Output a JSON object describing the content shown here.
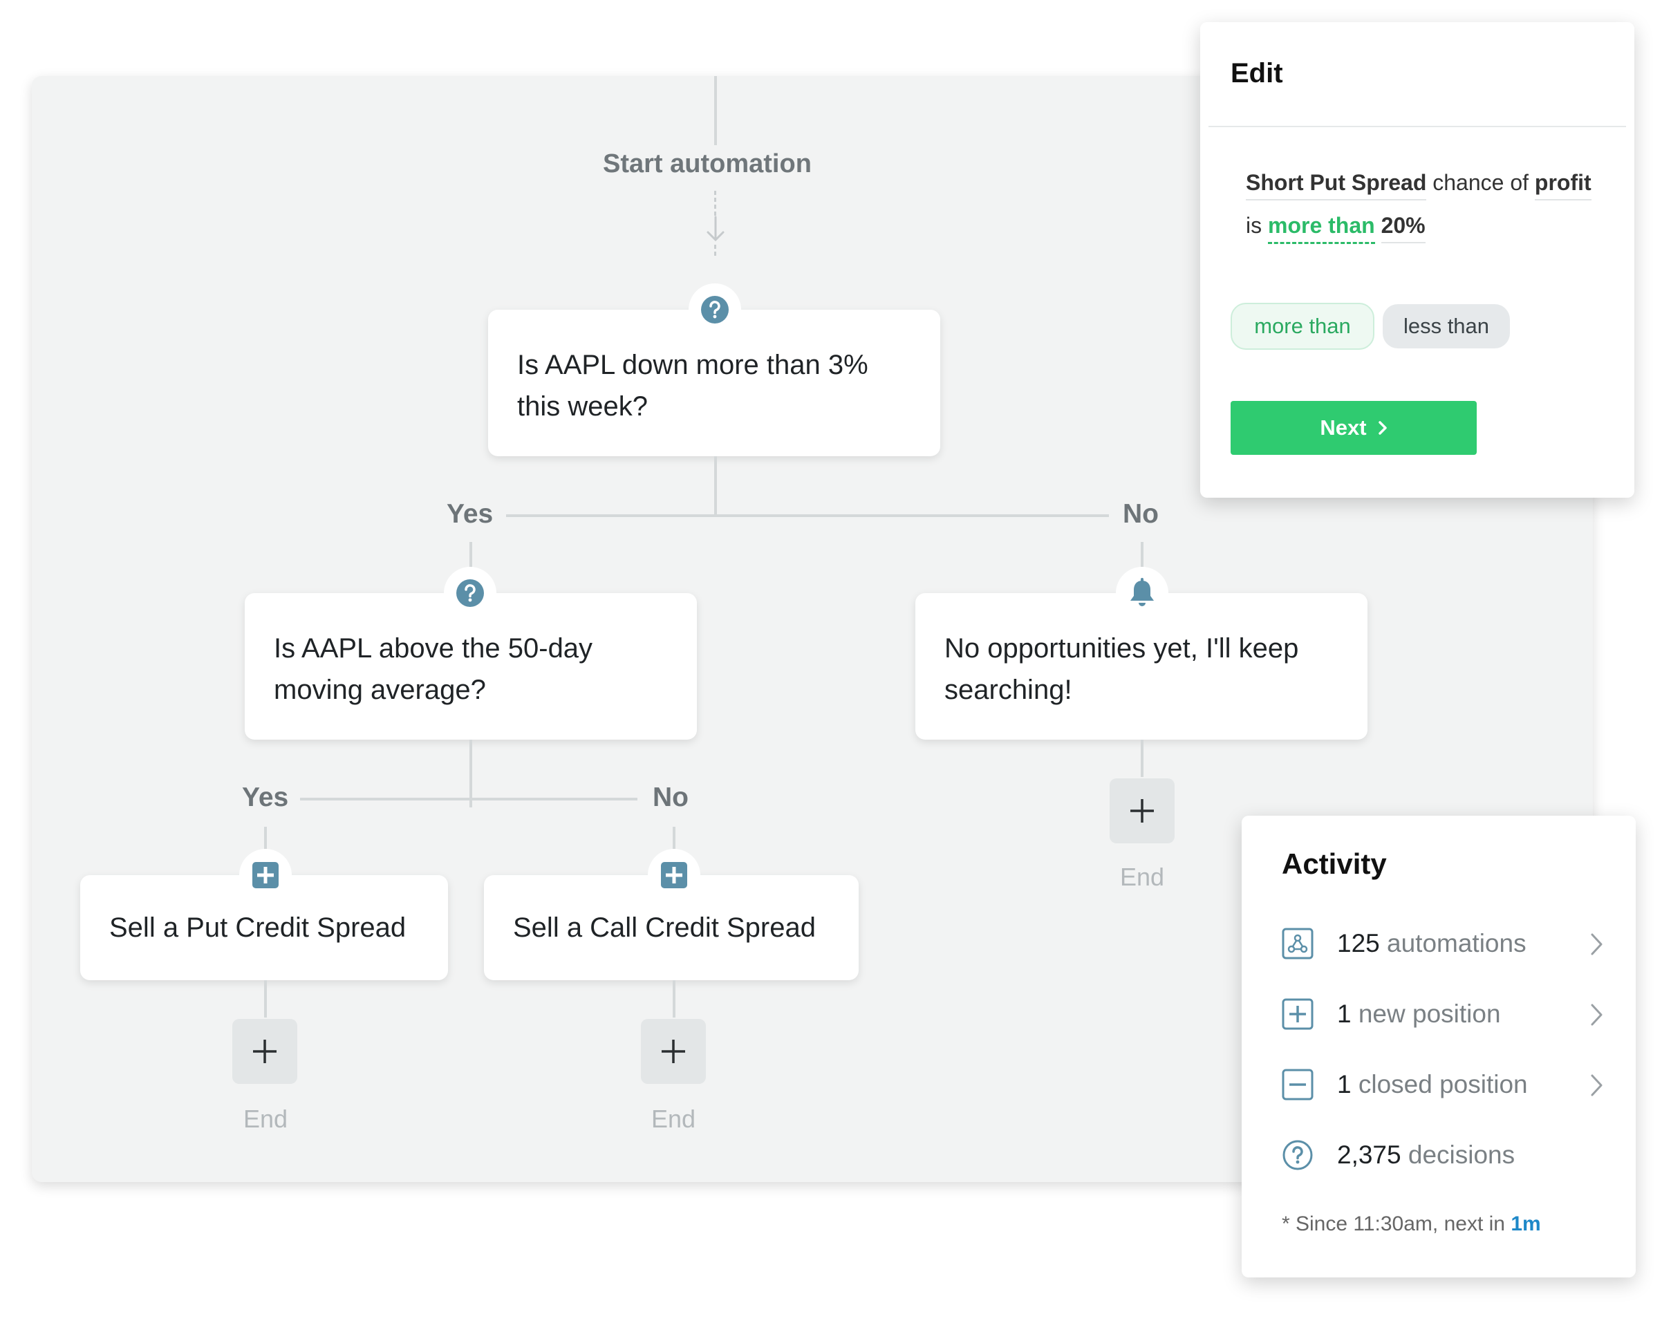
{
  "flow": {
    "start_label": "Start automation",
    "question1": "Is AAPL down more than 3% this week?",
    "yes1": "Yes",
    "no1": "No",
    "question2": "Is AAPL above the 50-day moving average?",
    "notify": "No opportunities yet, I'll keep searching!",
    "yes2": "Yes",
    "no2": "No",
    "action_put": "Sell a Put Credit Spread",
    "action_call": "Sell a Call Credit Spread",
    "end_label": "End"
  },
  "edit": {
    "title": "Edit",
    "condition": {
      "subject": "Short Put Spread",
      "word_chance": "chance",
      "word_of": "of",
      "metric": "profit",
      "word_is": "is",
      "operator": "more than",
      "value": "20%"
    },
    "options": [
      "more than",
      "less than"
    ],
    "next_label": "Next"
  },
  "activity": {
    "title": "Activity",
    "rows": [
      {
        "count": "125",
        "label": "automations",
        "icon": "automation-icon",
        "has_chevron": true
      },
      {
        "count": "1",
        "label": "new position",
        "icon": "plus-square-icon",
        "has_chevron": true
      },
      {
        "count": "1",
        "label": "closed position",
        "icon": "minus-square-icon",
        "has_chevron": true
      },
      {
        "count": "2,375",
        "label": "decisions",
        "icon": "question-circle-icon",
        "has_chevron": false
      }
    ],
    "footer_prefix": "* Since 11:30am, next in",
    "footer_highlight": "1m"
  },
  "colors": {
    "accent_green": "#2fcb70",
    "icon_blue": "#5b8fa8",
    "link_blue": "#1e88c8",
    "canvas_bg": "#f2f3f3"
  }
}
